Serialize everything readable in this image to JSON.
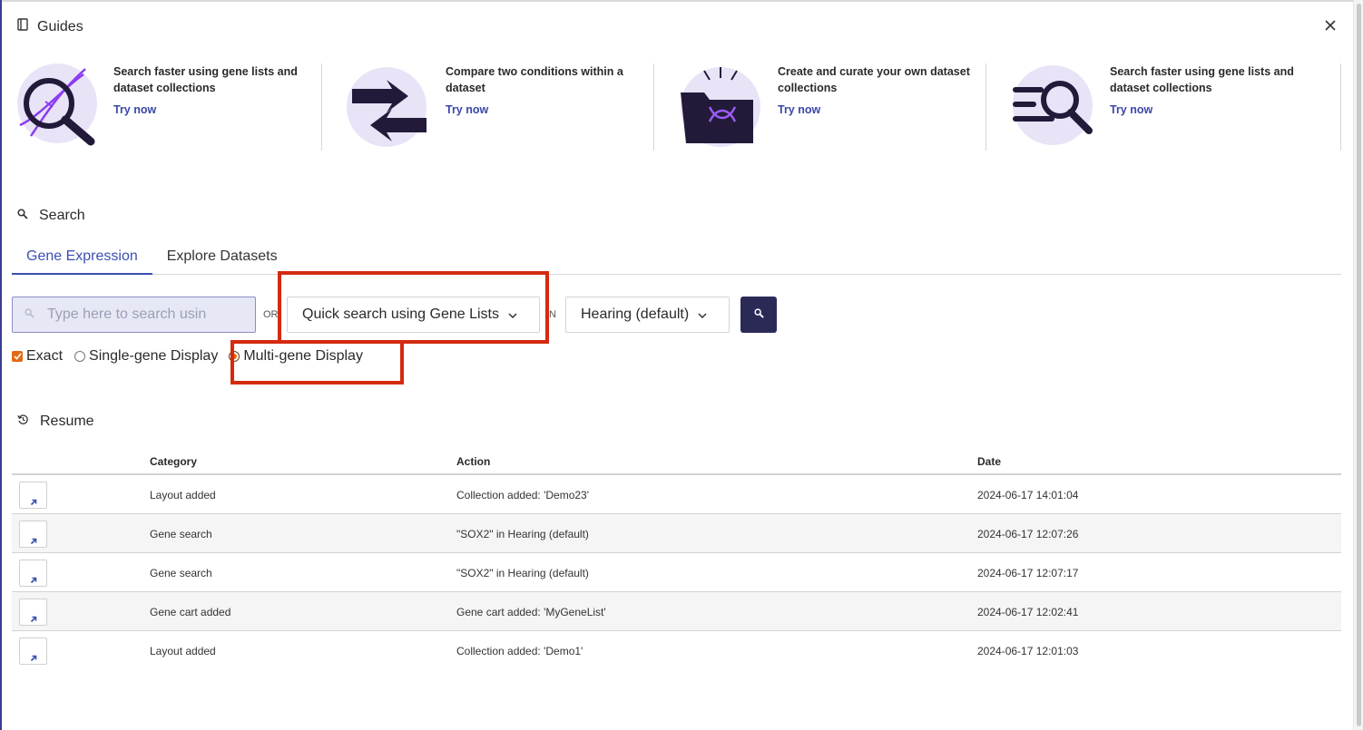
{
  "guides": {
    "title": "Guides",
    "cards": [
      {
        "title": "Search faster using gene lists and dataset collections",
        "link": "Try now"
      },
      {
        "title": "Compare two conditions within a dataset",
        "link": "Try now"
      },
      {
        "title": "Create and curate your own dataset collections",
        "link": "Try now"
      },
      {
        "title": "Search faster using gene lists and dataset collections",
        "link": "Try now"
      }
    ]
  },
  "search": {
    "title": "Search",
    "tabs": [
      {
        "label": "Gene Expression",
        "active": true
      },
      {
        "label": "Explore Datasets",
        "active": false
      }
    ],
    "input_placeholder": "Type here to search usin",
    "or_label": "OR",
    "gene_list_select": "Quick search using Gene Lists",
    "in_label": "IN",
    "dataset_select": "Hearing (default)",
    "options": {
      "exact": "Exact",
      "single_gene": "Single-gene Display",
      "multi_gene": "Multi-gene Display"
    }
  },
  "resume": {
    "title": "Resume",
    "columns": [
      "Category",
      "Action",
      "Date"
    ],
    "rows": [
      {
        "category": "Layout added",
        "action": "Collection added: 'Demo23'",
        "date": "2024-06-17 14:01:04"
      },
      {
        "category": "Gene search",
        "action": "\"SOX2\" in Hearing (default)",
        "date": "2024-06-17 12:07:26"
      },
      {
        "category": "Gene search",
        "action": "\"SOX2\" in Hearing (default)",
        "date": "2024-06-17 12:07:17"
      },
      {
        "category": "Gene cart added",
        "action": "Gene cart added: 'MyGeneList'",
        "date": "2024-06-17 12:02:41"
      },
      {
        "category": "Layout added",
        "action": "Collection added: 'Demo1'",
        "date": "2024-06-17 12:01:03"
      }
    ]
  },
  "colors": {
    "accent": "#3a4fb0",
    "highlight": "#d42a0f",
    "checkbox": "#e36a12",
    "button_dark": "#2b2a57",
    "illustration_purple": "#e9e3f7",
    "illustration_dark": "#231a3a"
  }
}
